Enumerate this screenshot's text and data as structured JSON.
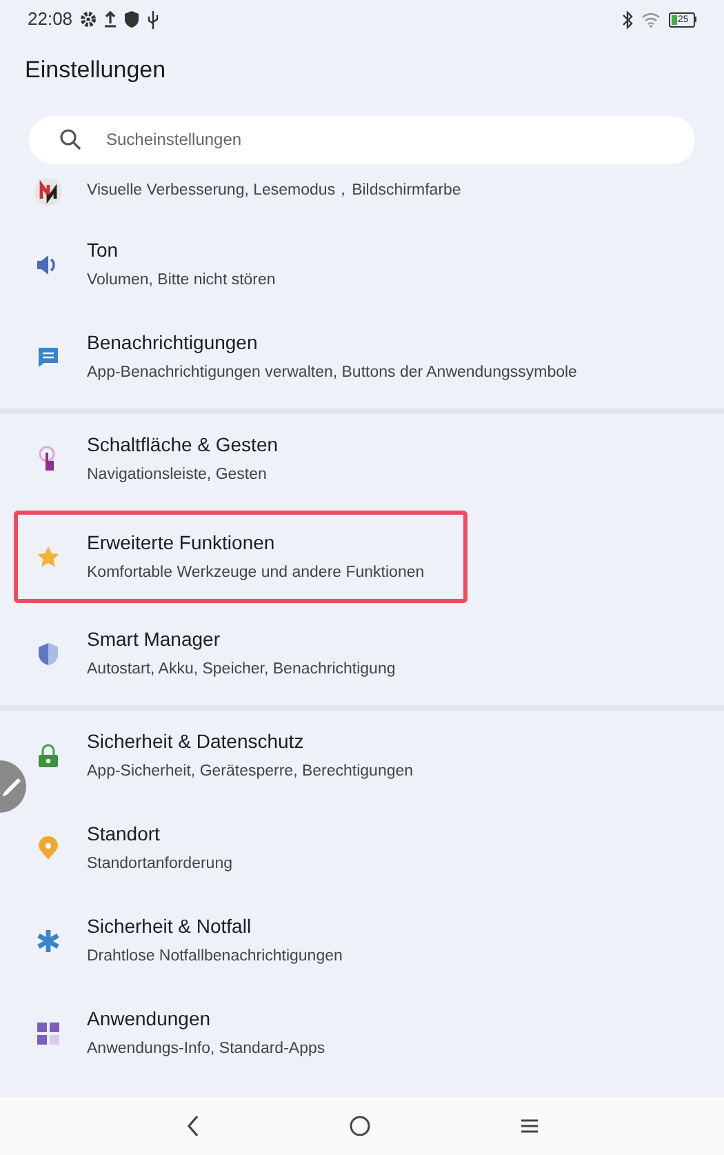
{
  "status_bar": {
    "time": "22:08",
    "battery": "25"
  },
  "title": "Einstellungen",
  "search": {
    "placeholder": "Sucheinstellungen"
  },
  "groups": [
    {
      "items": [
        {
          "subtitle": "Visuelle Verbesserung, Lesemodus，Bildschirmfarbe",
          "highlighted": false
        },
        {
          "title": "Ton",
          "subtitle": "Volumen, Bitte nicht stören",
          "highlighted": false
        },
        {
          "title": "Benachrichtigungen",
          "subtitle": "App-Benachrichtigungen verwalten, Buttons der Anwendungssymbole",
          "highlighted": false
        }
      ]
    },
    {
      "items": [
        {
          "title": "Schaltfläche & Gesten",
          "subtitle": "Navigationsleiste, Gesten",
          "highlighted": false
        },
        {
          "title": "Erweiterte Funktionen",
          "subtitle": "Komfortable Werkzeuge und andere Funktionen",
          "highlighted": true
        },
        {
          "title": "Smart Manager",
          "subtitle": "Autostart, Akku, Speicher, Benachrichtigung",
          "highlighted": false
        }
      ]
    },
    {
      "items": [
        {
          "title": "Sicherheit & Datenschutz",
          "subtitle": "App-Sicherheit, Gerätesperre, Berechtigungen",
          "highlighted": false
        },
        {
          "title": "Standort",
          "subtitle": "Standortanforderung",
          "highlighted": false
        },
        {
          "title": "Sicherheit & Notfall",
          "subtitle": "Drahtlose Notfallbenachrichtigungen",
          "highlighted": false
        },
        {
          "title": "Anwendungen",
          "subtitle": "Anwendungs-Info, Standard-Apps",
          "highlighted": false
        }
      ]
    }
  ]
}
